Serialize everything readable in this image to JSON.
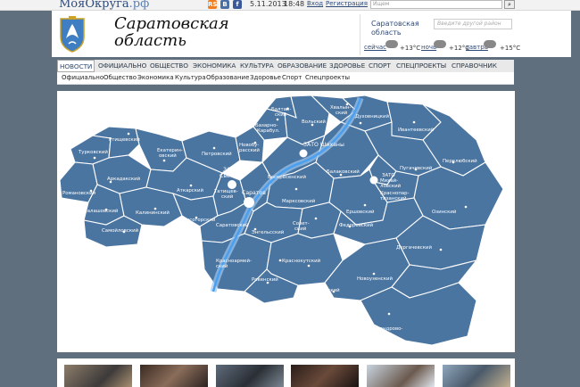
{
  "topbar": {
    "brand_main": "МояОкруга",
    "brand_suffix": ".рф",
    "social": [
      "RSS",
      "В",
      "f"
    ],
    "date": "5.11.2013",
    "time": "18:48",
    "login": "Вход",
    "register": "Регистрация",
    "search_placeholder": "Ищем",
    "search_button": "⌕"
  },
  "header": {
    "title_line1": "Саратовская",
    "title_line2": "область",
    "weather_title_line1": "Саратовская",
    "weather_title_line2": "область",
    "weather_search_placeholder": "Введите другой район",
    "forecast": [
      {
        "day": "сейчас",
        "temp": "+13°C"
      },
      {
        "day": "ночь",
        "temp": "+12°C"
      },
      {
        "day": "завтра",
        "temp": "+15°C"
      }
    ]
  },
  "nav_main": [
    "НОВОСТИ",
    "ОФИЦИАЛЬНО",
    "ОБЩЕСТВО",
    "ЭКОНОМИКА",
    "КУЛЬТУРА",
    "ОБРАЗОВАНИЕ",
    "ЗДОРОВЬЕ",
    "СПОРТ",
    "СПЕЦПРОЕКТЫ",
    "СПРАВОЧНИК"
  ],
  "nav_sub": [
    "Официально",
    "Общество",
    "Экономика",
    "Культура",
    "Образование",
    "Здоровье",
    "Спорт",
    "Спецпроекты"
  ],
  "map": {
    "districts": {
      "turkovsky": "Турковский",
      "rtishchevsky": "Ртищевский",
      "arkadaksky": "Аркадакский",
      "romanovsky": "Романовский",
      "balashovsky": "Балашовский",
      "samoilovsky": "Самойловский",
      "kalininsky": "Калининский",
      "ekaterinovsky_1": "Екатерин-",
      "ekaterinovsky_2": "овский",
      "petrovsky": "Петровский",
      "atkarsky": "Аткарский",
      "lysogorsky": "Лысогорский",
      "tatishchevsky_1": "Татищев-",
      "tatishchevsky_2": "ский",
      "zato_svetly_1": "ЗАТО",
      "zato_svetly_2": "Светлый",
      "saratov": "Саратов",
      "novoburassky_1": "Новобу-",
      "novoburassky_2": "расский",
      "bazarno_1": "Базарно-",
      "bazarno_2": "Карабул.",
      "baltaysky_1": "Балтай-",
      "baltaysky_2": "ский",
      "volsky": "Вольский",
      "khvalynsky_1": "Хвалын-",
      "khvalynsky_2": "ский",
      "dukhovnitsky": "Духовницкий",
      "zato_shikhany": "ЗАТО Шиханы",
      "ivanteevsky": "Ивантеевский",
      "perelyubsky": "Перелюбский",
      "pugachevsky": "Пугачевский",
      "voskresensky": "Воскресенский",
      "balakovsky": "Балаковский",
      "zato_mikhailovsky_1": "ЗАТО",
      "zato_mikhailovsky_2": "Михай-",
      "zato_mikhailovsky_3": "ловский",
      "krasnopartizansky_1": "Краснопар-",
      "krasnopartizansky_2": "тизанский",
      "marksovsky": "Марксовский",
      "ershovsky": "Ершовский",
      "ozinsky": "Озинский",
      "engelssky": "Энгельсский",
      "saratovsky": "Саратовский",
      "sovetsky_1": "Совет-",
      "sovetsky_2": "ский",
      "fedorovsky": "Федоровский",
      "dergachevsky": "Дергачевский",
      "krasnoarmeysky_1": "Красноармей-",
      "krasnoarmeysky_2": "ский",
      "krasnokutsky": "Краснокутский",
      "rovensky": "Ровенский",
      "piterksy": "Питерский",
      "novouzensky": "Новоузенский",
      "alexgai_1": "Александрово-",
      "alexgai_2": "Гайский"
    }
  },
  "thumbnails": [
    "photo-1",
    "photo-2",
    "photo-3",
    "photo-4",
    "photo-5",
    "photo-6"
  ]
}
